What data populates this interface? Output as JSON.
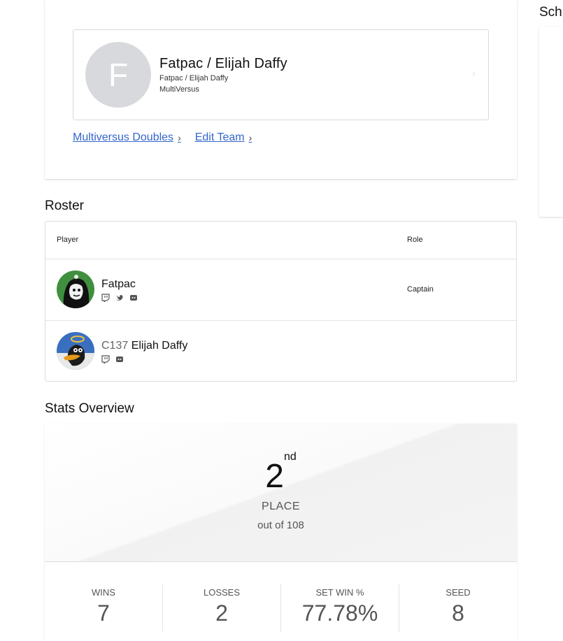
{
  "team": {
    "avatar_letter": "F",
    "name": "Fatpac / Elijah Daffy",
    "subtitle": "Fatpac / Elijah Daffy",
    "game": "MultiVersus",
    "links": [
      {
        "label": "Multiversus Doubles"
      },
      {
        "label": "Edit Team"
      }
    ]
  },
  "side": {
    "title": "Sch"
  },
  "roster": {
    "title": "Roster",
    "columns": {
      "player": "Player",
      "role": "Role"
    },
    "rows": [
      {
        "prefix": "",
        "name": "Fatpac",
        "role": "Captain",
        "socials": [
          "twitch-icon",
          "twitter-icon",
          "discord-icon"
        ]
      },
      {
        "prefix": "C137",
        "name": "Elijah Daffy",
        "role": "",
        "socials": [
          "twitch-icon",
          "discord-icon"
        ]
      }
    ]
  },
  "stats": {
    "title": "Stats Overview",
    "place": "2",
    "place_suffix": "nd",
    "place_label": "PLACE",
    "out_of": "out of 108",
    "items": [
      {
        "label": "WINS",
        "value": "7"
      },
      {
        "label": "LOSSES",
        "value": "2"
      },
      {
        "label": "SET WIN %",
        "value": "77.78%"
      },
      {
        "label": "SEED",
        "value": "8"
      }
    ]
  }
}
